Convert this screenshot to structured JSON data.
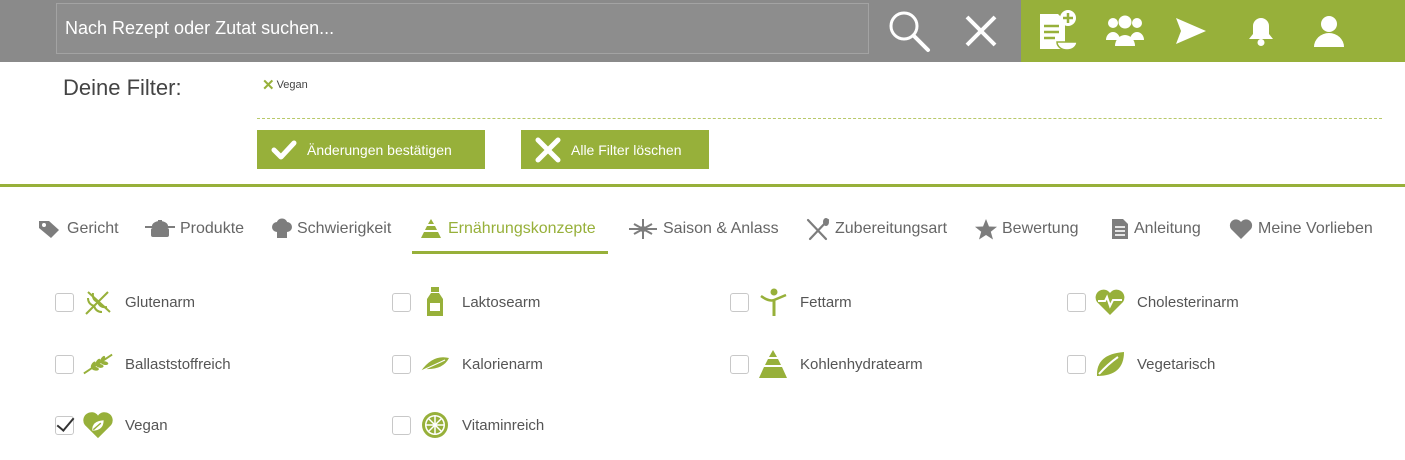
{
  "search": {
    "placeholder": "Nach Rezept oder Zutat suchen..."
  },
  "top_nav": {
    "icons": [
      "search-icon",
      "close-icon",
      "add-recipe-icon",
      "community-icon",
      "send-icon",
      "bell-icon",
      "user-icon"
    ]
  },
  "filters": {
    "label": "Deine Filter:",
    "active": [
      {
        "label": "Vegan"
      }
    ],
    "confirm_label": "Änderungen bestätigen",
    "clear_label": "Alle Filter löschen"
  },
  "tabs": [
    {
      "label": "Gericht",
      "icon": "tag-icon"
    },
    {
      "label": "Produkte",
      "icon": "pot-icon"
    },
    {
      "label": "Schwierigkeit",
      "icon": "chef-hat-icon"
    },
    {
      "label": "Ernährungskonzepte",
      "icon": "food-pyramid-icon",
      "active": true
    },
    {
      "label": "Saison & Anlass",
      "icon": "snowflake-sun-icon"
    },
    {
      "label": "Zubereitungsart",
      "icon": "utensils-icon"
    },
    {
      "label": "Bewertung",
      "icon": "star-icon"
    },
    {
      "label": "Anleitung",
      "icon": "document-icon"
    },
    {
      "label": "Meine Vorlieben",
      "icon": "heart-icon"
    }
  ],
  "options": [
    {
      "label": "Glutenarm",
      "icon": "wheat-crossed-icon",
      "checked": false
    },
    {
      "label": "Laktosearm",
      "icon": "milk-bottle-icon",
      "checked": false
    },
    {
      "label": "Fettarm",
      "icon": "slim-figure-icon",
      "checked": false
    },
    {
      "label": "Cholesterinarm",
      "icon": "heart-pulse-icon",
      "checked": false
    },
    {
      "label": "Ballaststoffreich",
      "icon": "grain-icon",
      "checked": false
    },
    {
      "label": "Kalorienarm",
      "icon": "feather-icon",
      "checked": false
    },
    {
      "label": "Kohlenhydratearm",
      "icon": "food-pyramid-icon",
      "checked": false
    },
    {
      "label": "Vegetarisch",
      "icon": "leaf-icon",
      "checked": false
    },
    {
      "label": "Vegan",
      "icon": "heart-leaf-icon",
      "checked": true
    },
    {
      "label": "Vitaminreich",
      "icon": "citrus-icon",
      "checked": false
    }
  ],
  "colors": {
    "accent": "#97b03a",
    "topbar": "#8a8a8a"
  }
}
